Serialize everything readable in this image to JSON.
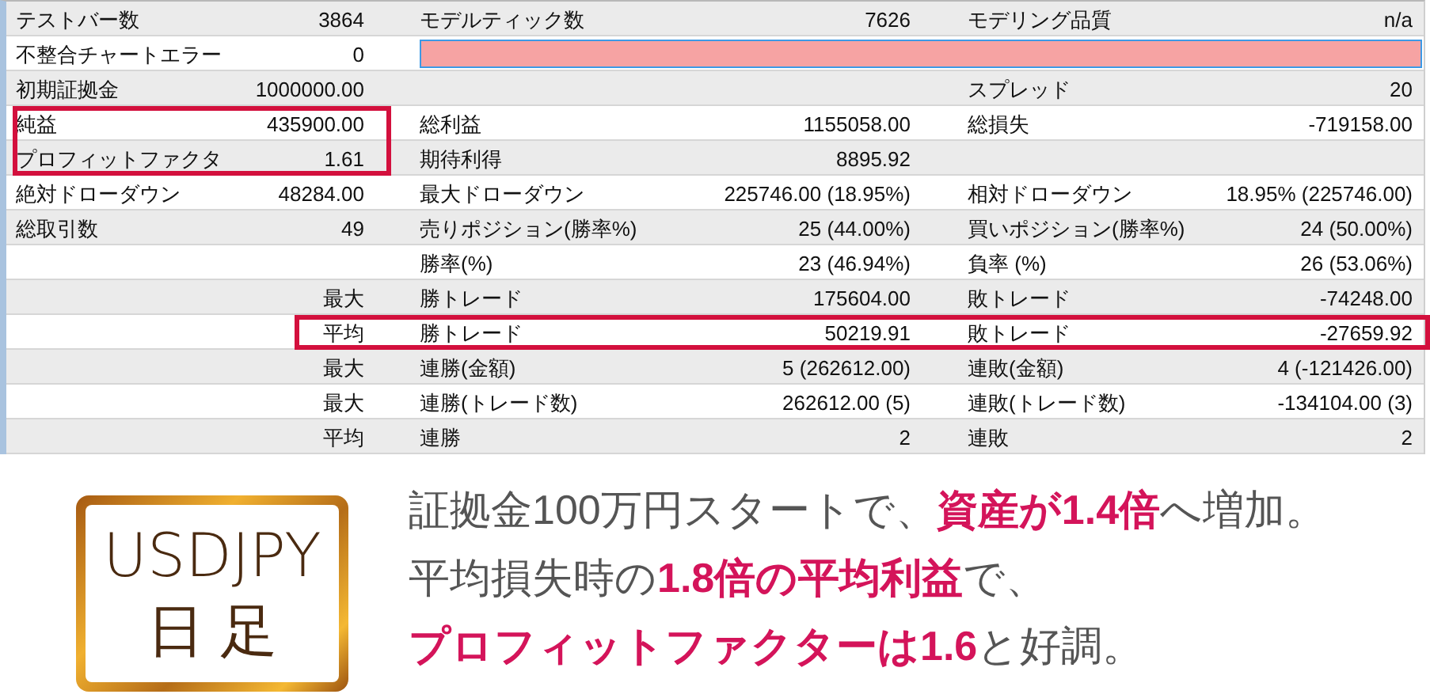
{
  "table": {
    "rows": [
      {
        "kind": "stats",
        "frame_left": false,
        "frame_right": false,
        "label_1": "テストバー数",
        "value_1": "3864",
        "label_2": "モデルティック数",
        "value_2": "7626",
        "label_3": "モデリング品質",
        "value_3": "n/a"
      },
      {
        "kind": "error_bar",
        "frame_left": false,
        "frame_right": false,
        "label_1": "不整合チャートエラー",
        "value_1": "0"
      },
      {
        "kind": "stats",
        "frame_left": false,
        "frame_right": false,
        "label_1": "初期証拠金",
        "value_1": "1000000.00",
        "label_3": "スプレッド",
        "value_3": "20"
      },
      {
        "kind": "stats",
        "frame_left": true,
        "frame_right": false,
        "label_1": "純益",
        "value_1": "435900.00",
        "label_2": "総利益",
        "value_2": "1155058.00",
        "label_3": "総損失",
        "value_3": "-719158.00"
      },
      {
        "kind": "stats",
        "frame_left": true,
        "frame_right": false,
        "label_1": "プロフィットファクタ",
        "value_1": "1.61",
        "label_2": "期待利得",
        "value_2": "8895.92"
      },
      {
        "kind": "stats",
        "frame_left": false,
        "frame_right": false,
        "label_1": "絶対ドローダウン",
        "value_1": "48284.00",
        "label_2": "最大ドローダウン",
        "value_2": "225746.00 (18.95%)",
        "label_3": "相対ドローダウン",
        "value_3": "18.95% (225746.00)"
      },
      {
        "kind": "stats",
        "frame_left": false,
        "frame_right": false,
        "label_1": "総取引数",
        "value_1": "49",
        "label_2": "売りポジション(勝率%)",
        "value_2": "25 (44.00%)",
        "label_3": "買いポジション(勝率%)",
        "value_3": "24 (50.00%)"
      },
      {
        "kind": "stats",
        "frame_left": false,
        "frame_right": false,
        "label_2": "勝率(%)",
        "value_2": "23 (46.94%)",
        "label_3": "負率 (%)",
        "value_3": "26 (53.06%)"
      },
      {
        "kind": "stats",
        "frame_left": false,
        "frame_right": false,
        "value_1": "最大",
        "label_2": "勝トレード",
        "value_2": "175604.00",
        "label_3": "敗トレード",
        "value_3": "-74248.00"
      },
      {
        "kind": "stats",
        "frame_left": false,
        "frame_right": true,
        "value_1": "平均",
        "label_2": "勝トレード",
        "value_2": "50219.91",
        "label_3": "敗トレード",
        "value_3": "-27659.92"
      },
      {
        "kind": "stats",
        "frame_left": false,
        "frame_right": false,
        "value_1": "最大",
        "label_2": "連勝(金額)",
        "value_2": "5 (262612.00)",
        "label_3": "連敗(金額)",
        "value_3": "4 (-121426.00)"
      },
      {
        "kind": "stats",
        "frame_left": false,
        "frame_right": false,
        "value_1": "最大",
        "label_2": "連勝(トレード数)",
        "value_2": "262612.00 (5)",
        "label_3": "連敗(トレード数)",
        "value_3": "-134104.00 (3)"
      },
      {
        "kind": "stats",
        "frame_left": false,
        "frame_right": false,
        "value_1": "平均",
        "label_2": "連勝",
        "value_2": "2",
        "label_3": "連敗",
        "value_3": "2"
      }
    ]
  },
  "badge": {
    "title": "USDJPY",
    "subtitle": "日 足"
  },
  "summary": [
    "証拠金100万円スタートで、**資産が1.4倍**へ増加。",
    "平均損失時の**1.8倍の平均利益**で、",
    "**プロフィットファクターは1.6**と好調。"
  ]
}
